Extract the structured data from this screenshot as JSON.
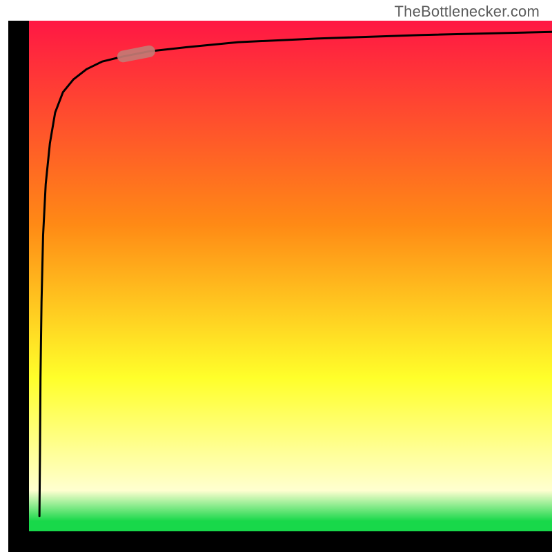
{
  "attribution": "TheBottlenecker.com",
  "colors": {
    "red": "#ff1744",
    "orange": "#ff8a15",
    "yellow": "#ffff2a",
    "pale_yellow": "#ffffd0",
    "green": "#18d84a",
    "axis": "#000000",
    "curve": "#000000",
    "marker": "#c47a74"
  },
  "chart_data": {
    "type": "line",
    "title": "",
    "xlabel": "",
    "ylabel": "",
    "xlim": [
      0,
      100
    ],
    "ylim": [
      0,
      100
    ],
    "series": [
      {
        "name": "bottleneck-curve",
        "x": [
          2.0,
          2.1,
          2.2,
          2.4,
          2.7,
          3.2,
          4.0,
          5.0,
          6.5,
          8.5,
          11.0,
          14.0,
          18.0,
          23.0,
          30.0,
          40.0,
          55.0,
          75.0,
          100.0
        ],
        "y": [
          3.0,
          15.0,
          30.0,
          45.0,
          58.0,
          68.0,
          76.0,
          82.0,
          86.0,
          88.5,
          90.5,
          92.0,
          93.0,
          94.0,
          94.8,
          95.8,
          96.5,
          97.2,
          97.8
        ]
      }
    ],
    "marker": {
      "x_start": 18.0,
      "x_end": 23.0
    },
    "gradient_stops_y": [
      {
        "y": 100,
        "color": "#ff1744"
      },
      {
        "y": 60,
        "color": "#ff8a15"
      },
      {
        "y": 30,
        "color": "#ffff2a"
      },
      {
        "y": 8,
        "color": "#ffffd0"
      },
      {
        "y": 2,
        "color": "#18d84a"
      }
    ]
  }
}
